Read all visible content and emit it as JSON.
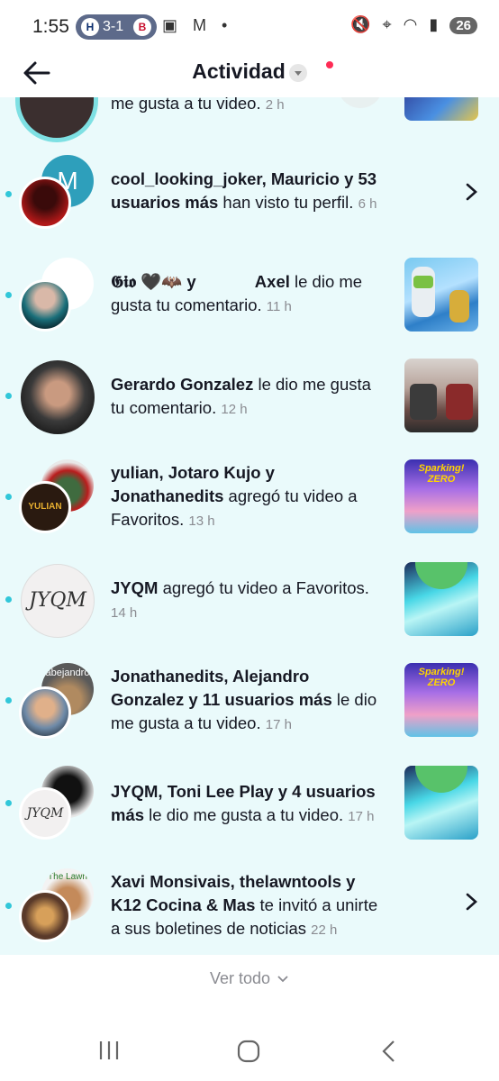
{
  "status_bar": {
    "time": "1:55",
    "score": "3-1",
    "team_left": "H",
    "team_right": "B",
    "left_icons": "▣ M •",
    "battery": "26"
  },
  "header": {
    "title": "Actividad"
  },
  "notifications": [
    {
      "text_tail": "me gusta a tu video.",
      "time": "2 h"
    },
    {
      "bold1": "cool_looking_joker, Mauricio y 53",
      "bold2": "usuarios más",
      "rest": " han visto tu perfil.",
      "time": "6 h",
      "avatar_letter": "M"
    },
    {
      "bold1": "𝕲𝖎𝖔 🖤🦇",
      "mid": " y ",
      "bold2": "Axel",
      "rest": " le dio me gusta tu comentario.",
      "time": "11 h"
    },
    {
      "bold1": "Gerardo Gonzalez",
      "rest": " le dio me gusta tu comentario.",
      "time": "12 h"
    },
    {
      "bold1": "yulian, Jotaro Kujo y Jonathanedits",
      "rest": " agregó tu video a Favoritos.",
      "time": "13 h",
      "avatar_text": "YULIAN"
    },
    {
      "bold1": "JYQM",
      "rest": " agregó tu video a Favoritos.",
      "time": "14 h",
      "avatar_text": "JYQM"
    },
    {
      "bold1": "Jonathanedits, Alejandro Gonzalez y 11 usuarios más",
      "rest": " le dio me gusta a tu video.",
      "time": "17 h",
      "avatar_text": "abejandro"
    },
    {
      "bold1": "JYQM, Toni Lee Play y 4 usuarios más",
      "rest": " le dio me gusta a tu video.",
      "time": "17 h",
      "avatar_text": "JYQM"
    },
    {
      "bold1": "Xavi Monsivais, thelawntools y K12 Cocina & Mas",
      "rest": " te invitó a unirte a sus boletines de noticias",
      "time": "22 h",
      "avatar_text": "The Lawn"
    }
  ],
  "thumb_labels": {
    "sparking": "Sparking! ZERO"
  },
  "footer": {
    "see_all": "Ver todo"
  },
  "colors": {
    "list_bg": "#eafafb",
    "unread_dot": "#31c7d9",
    "accent_red": "#fe2c55"
  },
  "icons": [
    "back-arrow-icon",
    "dropdown-icon",
    "chevron-right-icon",
    "chevron-down-icon",
    "recents-icon",
    "home-icon",
    "back-icon"
  ]
}
